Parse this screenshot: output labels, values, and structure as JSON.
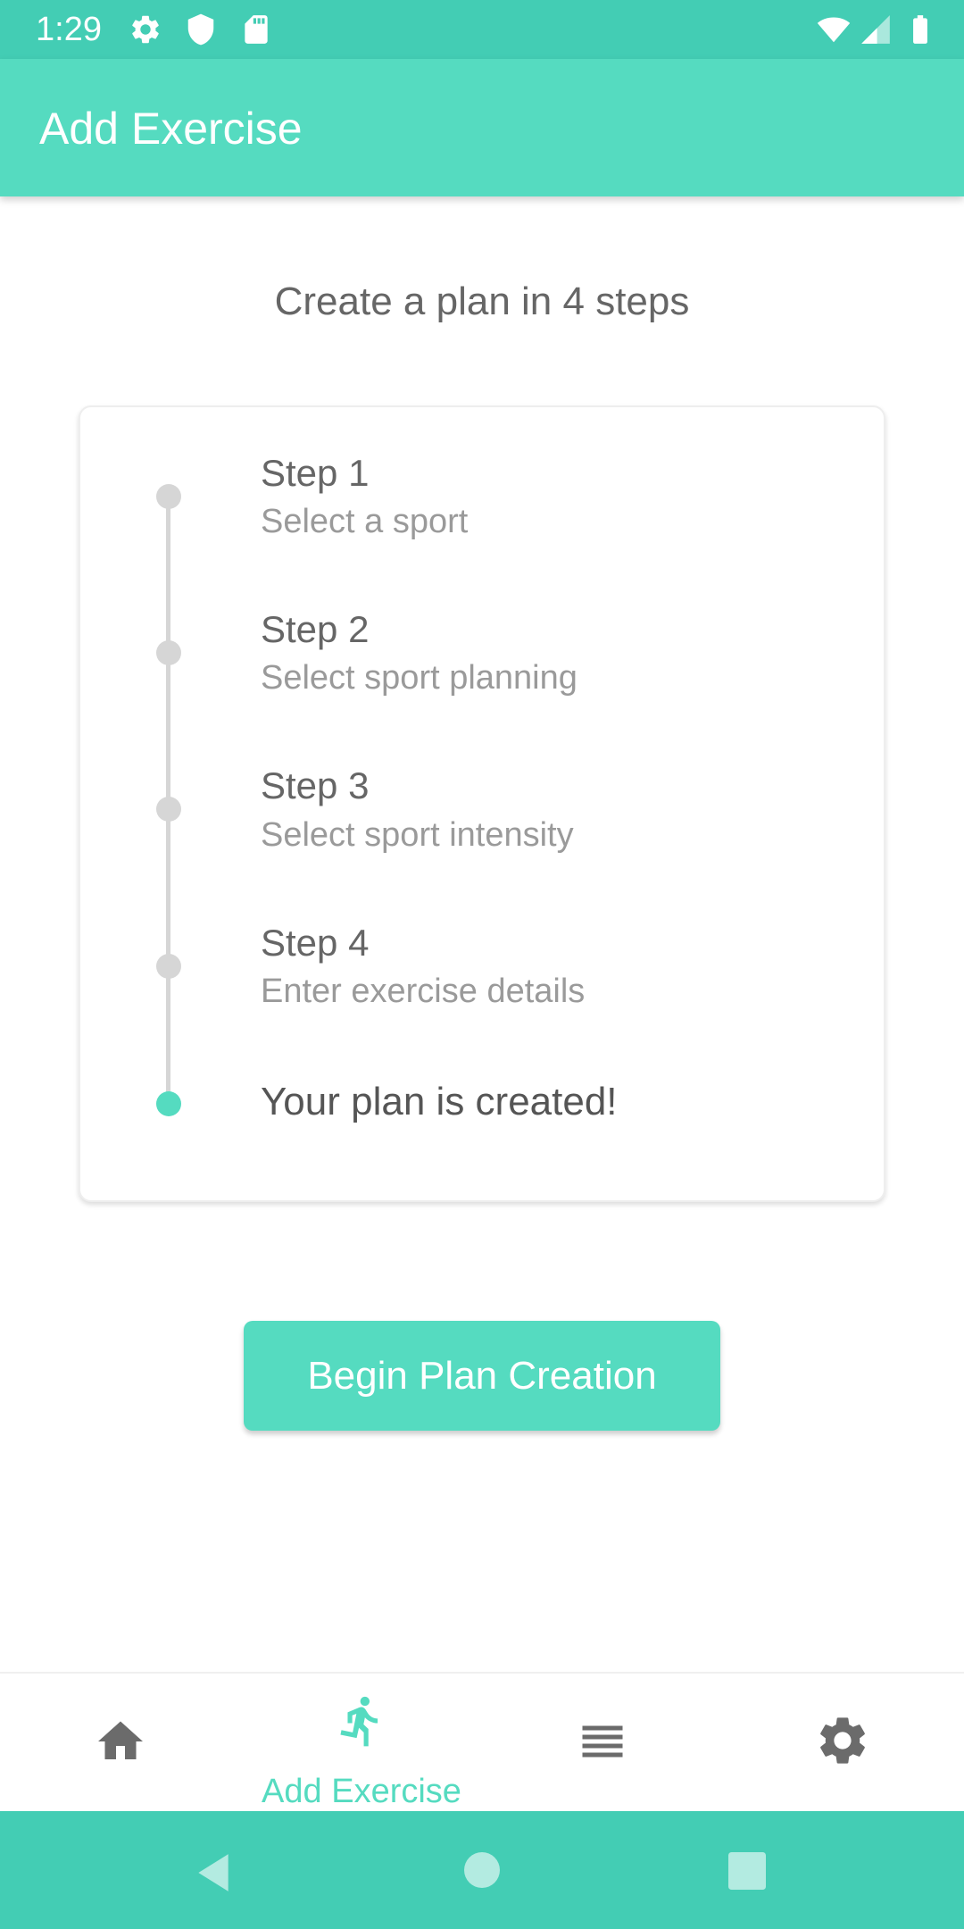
{
  "status_bar": {
    "time": "1:29",
    "icons": [
      "gear-icon",
      "shield-icon",
      "sd-card-icon",
      "wifi-icon",
      "signal-icon",
      "battery-icon"
    ]
  },
  "app_bar": {
    "title": "Add Exercise"
  },
  "heading": "Create a plan in 4 steps",
  "steps": [
    {
      "title": "Step 1",
      "description": "Select a sport"
    },
    {
      "title": "Step 2",
      "description": "Select sport planning"
    },
    {
      "title": "Step 3",
      "description": "Select sport intensity"
    },
    {
      "title": "Step 4",
      "description": "Enter exercise details"
    }
  ],
  "final_step": "Your plan is created!",
  "begin_button": "Begin Plan Creation",
  "bottom_nav": {
    "items": [
      {
        "icon": "home-icon",
        "label": ""
      },
      {
        "icon": "running-icon",
        "label": "Add Exercise",
        "active": true
      },
      {
        "icon": "list-icon",
        "label": ""
      },
      {
        "icon": "settings-icon",
        "label": ""
      }
    ]
  },
  "colors": {
    "accent": "#55DBC0",
    "status_bar": "#43CDB4",
    "text_primary": "#666666",
    "text_secondary": "#9a9a9a",
    "inactive_icon": "#6b6b6b"
  }
}
